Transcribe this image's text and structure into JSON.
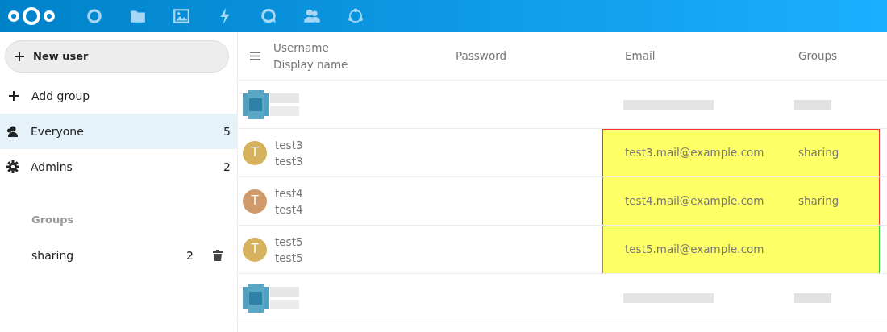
{
  "sidebar": {
    "new_user": "New user",
    "add_group": "Add group",
    "items": [
      {
        "kind": "everyone",
        "label": "Everyone",
        "count": "5",
        "selected": true
      },
      {
        "kind": "admins",
        "label": "Admins",
        "count": "2",
        "selected": false
      }
    ],
    "groups_caption": "Groups",
    "groups": [
      {
        "label": "sharing",
        "count": "2",
        "selected": false
      }
    ]
  },
  "table": {
    "columns": [
      "Username",
      "Display name",
      "Password",
      "Email",
      "Groups"
    ],
    "rows": [
      {
        "kind": "picture"
      },
      {
        "kind": "user",
        "avatar": "T",
        "color": "#d6b25f",
        "username": "test3",
        "display_name": "test3",
        "email": "test3.mail@example.com",
        "groups": "sharing",
        "highlight": {
          "color": "#ff3333"
        }
      },
      {
        "kind": "user",
        "avatar": "T",
        "color": "#d09a6a",
        "username": "test4",
        "display_name": "test4",
        "email": "test4.mail@example.com",
        "groups": "sharing",
        "highlight": {
          "color": "#ff3333"
        }
      },
      {
        "kind": "user",
        "avatar": "T",
        "color": "#d6b25f",
        "username": "test5",
        "display_name": "test5",
        "email": "test5.mail@example.com",
        "highlight": {
          "color": "#33cc33"
        }
      },
      {
        "kind": "picture"
      }
    ]
  }
}
